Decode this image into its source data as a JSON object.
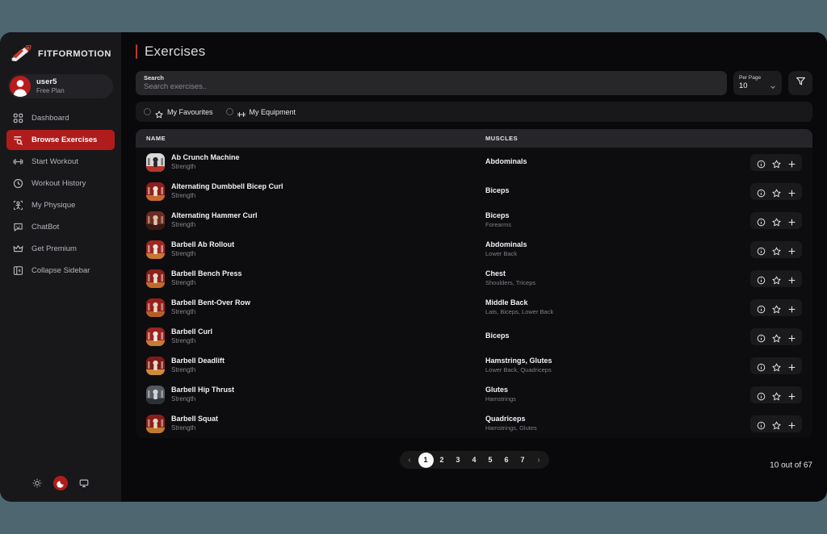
{
  "colors": {
    "desktop_bg": "#4d666f",
    "app_bg": "#09090b",
    "sidebar_bg": "#18181b",
    "accent_red": "#b01c1c",
    "title_accent": "#c0392b"
  },
  "sidebar": {
    "brand": "FITFORMOTION",
    "brand_logo_icon": "rocket-logo-icon",
    "user": {
      "name": "user5",
      "plan": "Free Plan",
      "avatar_icon": "avatar-icon"
    },
    "items": [
      {
        "label": "Dashboard",
        "icon": "grid-icon",
        "active": false
      },
      {
        "label": "Browse Exercises",
        "icon": "list-search-icon",
        "active": true
      },
      {
        "label": "Start Workout",
        "icon": "dumbbell-icon",
        "active": false
      },
      {
        "label": "Workout History",
        "icon": "clock-history-icon",
        "active": false
      },
      {
        "label": "My Physique",
        "icon": "body-icon",
        "active": false
      },
      {
        "label": "ChatBot",
        "icon": "chat-bubble-icon",
        "active": false
      },
      {
        "label": "Get Premium",
        "icon": "crown-icon",
        "active": false
      },
      {
        "label": "Collapse Sidebar",
        "icon": "panel-collapse-icon",
        "active": false
      }
    ],
    "theme": [
      {
        "name": "sun-icon",
        "active": false
      },
      {
        "name": "moon-icon",
        "active": true
      },
      {
        "name": "monitor-icon",
        "active": false
      }
    ]
  },
  "header": {
    "title": "Exercises"
  },
  "search": {
    "label": "Search",
    "placeholder": "Search exercises..",
    "value": ""
  },
  "per_page": {
    "label": "Per Page",
    "value": "10",
    "chevron_icon": "chevron-down-icon"
  },
  "filter_button": {
    "icon": "filter-funnel-icon"
  },
  "chips": [
    {
      "label": "My Favourites",
      "icon": "star-icon",
      "checked": false
    },
    {
      "label": "My Equipment",
      "icon": "dumbbell-icon",
      "checked": false
    }
  ],
  "table": {
    "columns": [
      "NAME",
      "MUSCLES"
    ],
    "row_actions": [
      "info-icon",
      "star-icon",
      "plus-icon"
    ],
    "rows": [
      {
        "name": "Ab Crunch Machine",
        "type": "Strength",
        "muscle_primary": "Abdominals",
        "muscle_secondary": ""
      },
      {
        "name": "Alternating Dumbbell Bicep Curl",
        "type": "Strength",
        "muscle_primary": "Biceps",
        "muscle_secondary": ""
      },
      {
        "name": "Alternating Hammer Curl",
        "type": "Strength",
        "muscle_primary": "Biceps",
        "muscle_secondary": "Forearms"
      },
      {
        "name": "Barbell Ab Rollout",
        "type": "Strength",
        "muscle_primary": "Abdominals",
        "muscle_secondary": "Lower Back"
      },
      {
        "name": "Barbell Bench Press",
        "type": "Strength",
        "muscle_primary": "Chest",
        "muscle_secondary": "Shoulders, Triceps"
      },
      {
        "name": "Barbell Bent-Over Row",
        "type": "Strength",
        "muscle_primary": "Middle Back",
        "muscle_secondary": "Lats, Biceps, Lower Back"
      },
      {
        "name": "Barbell Curl",
        "type": "Strength",
        "muscle_primary": "Biceps",
        "muscle_secondary": ""
      },
      {
        "name": "Barbell Deadlift",
        "type": "Strength",
        "muscle_primary": "Hamstrings, Glutes",
        "muscle_secondary": "Lower Back, Quadriceps"
      },
      {
        "name": "Barbell Hip Thrust",
        "type": "Strength",
        "muscle_primary": "Glutes",
        "muscle_secondary": "Hamstrings"
      },
      {
        "name": "Barbell Squat",
        "type": "Strength",
        "muscle_primary": "Quadriceps",
        "muscle_secondary": "Hamstrings, Glutes"
      }
    ]
  },
  "pagination": {
    "prev_icon": "chevron-left-icon",
    "next_icon": "chevron-right-icon",
    "pages": [
      "1",
      "2",
      "3",
      "4",
      "5",
      "6",
      "7"
    ],
    "active_page": "1",
    "count_label": "10 out of 67"
  }
}
